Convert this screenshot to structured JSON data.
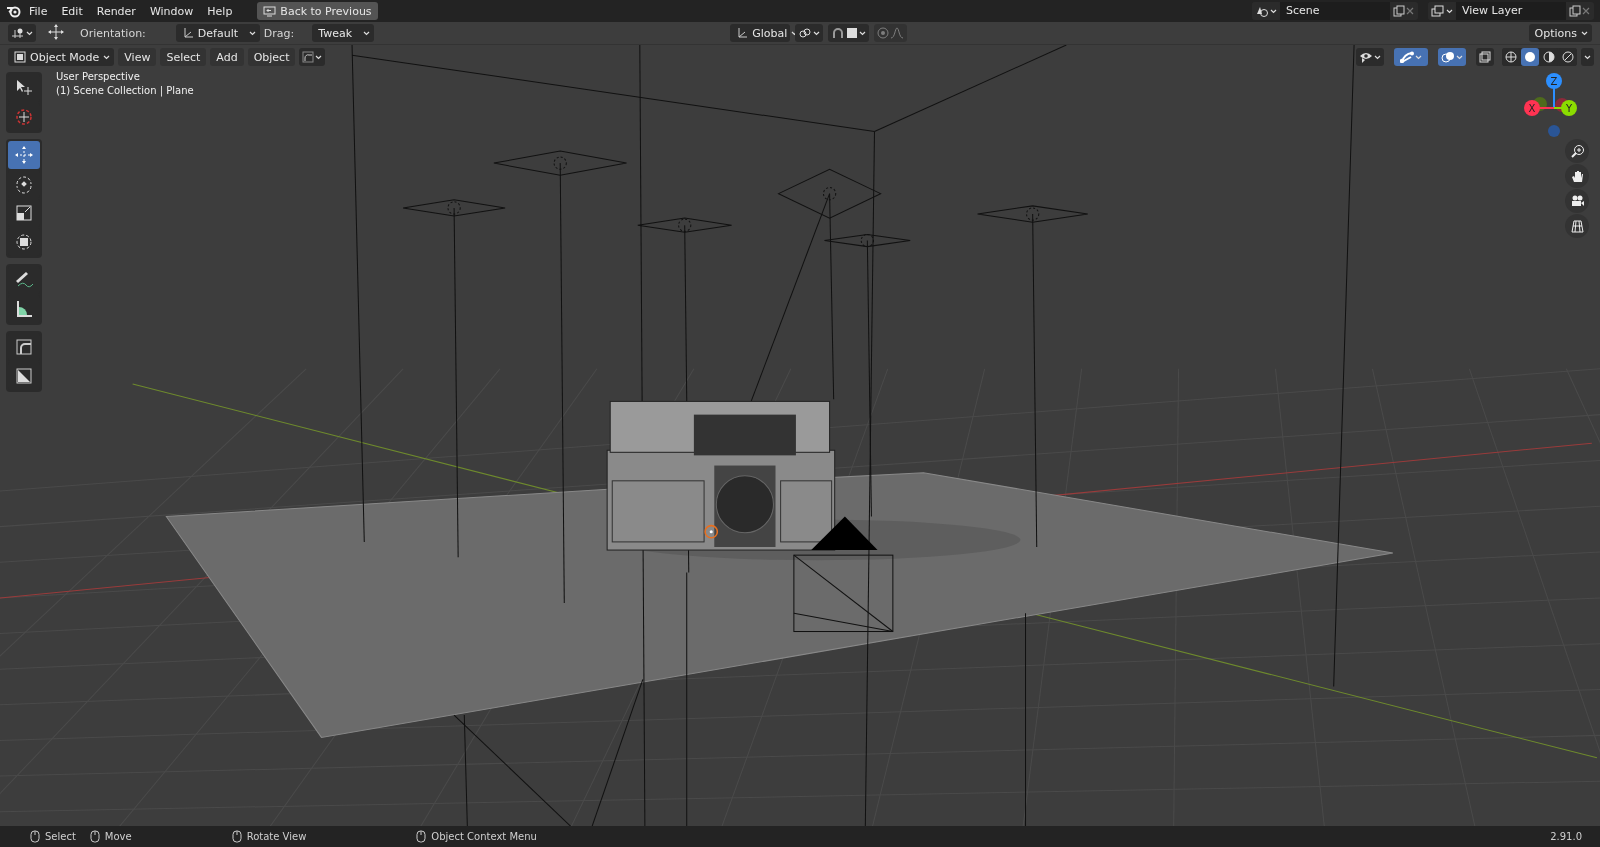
{
  "topbar": {
    "menus": [
      "File",
      "Edit",
      "Render",
      "Window",
      "Help"
    ],
    "back_button": "Back to Previous",
    "scene": "Scene",
    "view_layer": "View Layer"
  },
  "tool_header": {
    "orientation_label": "Orientation:",
    "orientation": "Default",
    "drag_label": "Drag:",
    "drag": "Tweak",
    "transform_orientation": "Global",
    "snap": false,
    "proportional_editing": false,
    "options": "Options"
  },
  "viewport_header": {
    "mode": "Object Mode",
    "menus": [
      "View",
      "Select",
      "Add",
      "Object"
    ],
    "show_gizmo": true,
    "show_overlays": true,
    "xray": false,
    "shading": [
      {
        "kind": "wireframe",
        "selected": false
      },
      {
        "kind": "solid",
        "selected": true
      },
      {
        "kind": "material",
        "selected": false
      },
      {
        "kind": "rendered",
        "selected": false
      }
    ]
  },
  "toolbar": {
    "groups": [
      [
        {
          "kind": "select",
          "selected": false
        },
        {
          "kind": "cursor",
          "selected": false
        }
      ],
      [
        {
          "kind": "move",
          "selected": true
        },
        {
          "kind": "rotate",
          "selected": false
        },
        {
          "kind": "scale",
          "selected": false
        },
        {
          "kind": "transform",
          "selected": false
        }
      ],
      [
        {
          "kind": "annotate",
          "selected": false
        },
        {
          "kind": "measure",
          "selected": false
        }
      ],
      [
        {
          "kind": "corner",
          "selected": false
        },
        {
          "kind": "half",
          "selected": false
        }
      ]
    ]
  },
  "viewport": {
    "perspective": "User Perspective",
    "collection": "(1) Scene Collection | Plane"
  },
  "gizmo": {
    "axes": [
      {
        "label": "Z"
      },
      {
        "label": "X"
      },
      {
        "label": "Y"
      }
    ]
  },
  "status_bar": {
    "hints": [
      "Select",
      "Move",
      "Rotate View",
      "Object Context Menu"
    ],
    "version": "2.91.0"
  }
}
